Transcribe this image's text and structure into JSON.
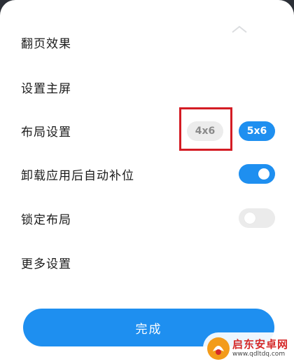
{
  "settings": {
    "items": [
      {
        "label": "翻页效果"
      },
      {
        "label": "设置主屏"
      },
      {
        "label": "布局设置"
      },
      {
        "label": "卸载应用后自动补位"
      },
      {
        "label": "锁定布局"
      },
      {
        "label": "更多设置"
      }
    ],
    "layout_options": [
      "4x6",
      "5x6"
    ],
    "layout_selected": "5x6",
    "auto_fill_enabled": true,
    "lock_layout_enabled": false
  },
  "done_label": "完成",
  "watermark": {
    "name": "启东安卓网",
    "url": "www.qdltdq.com"
  },
  "colors": {
    "accent": "#1e8ff0",
    "highlight": "#d41c24"
  }
}
